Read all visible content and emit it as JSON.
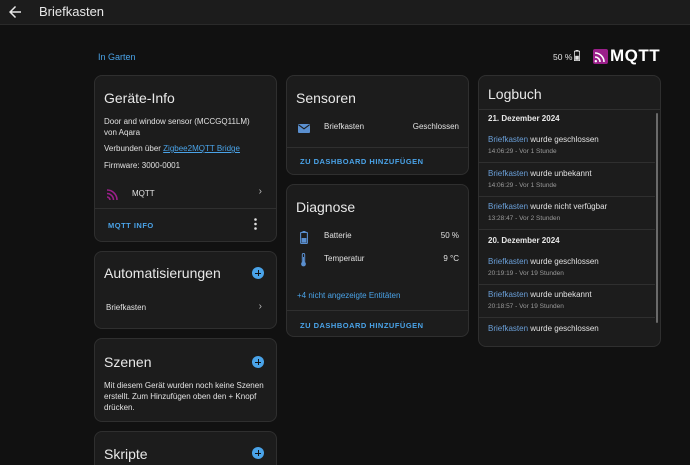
{
  "header": {
    "title": "Briefkasten"
  },
  "area": {
    "link": "In Garten"
  },
  "status": {
    "battery": "50 %"
  },
  "brand": {
    "logo_text": "MQTT",
    "accent": "#9b1f8a"
  },
  "device_info": {
    "title": "Geräte-Info",
    "model": "Door and window sensor (MCCGQ11LM)",
    "manufacturer": "von Aqara",
    "connected_prefix": "Verbunden über ",
    "connected_link": "Zigbee2MQTT Bridge",
    "firmware": "Firmware: 3000-0001",
    "integration_label": "MQTT",
    "button": "MQTT INFO"
  },
  "automations": {
    "title": "Automatisierungen",
    "item": "Briefkasten"
  },
  "scenes": {
    "title": "Szenen",
    "text": "Mit diesem Gerät wurden noch keine Szenen erstellt. Zum Hinzufügen oben den + Knopf drücken."
  },
  "scripts": {
    "title": "Skripte"
  },
  "sensors": {
    "title": "Sensoren",
    "rows": [
      {
        "name": "Briefkasten",
        "value": "Geschlossen"
      }
    ],
    "add_button": "ZU DASHBOARD HINZUFÜGEN"
  },
  "diagnostics": {
    "title": "Diagnose",
    "rows": [
      {
        "name": "Batterie",
        "value": "50 %"
      },
      {
        "name": "Temperatur",
        "value": "9 °C"
      }
    ],
    "hidden_entities": "+4 nicht angezeigte Entitäten",
    "add_button": "ZU DASHBOARD HINZUFÜGEN"
  },
  "logbook": {
    "title": "Logbuch",
    "days": [
      {
        "date": "21. Dezember 2024",
        "entries": [
          {
            "entity": "Briefkasten",
            "text": " wurde geschlossen",
            "time": "14:06:29 - Vor 1 Stunde"
          },
          {
            "entity": "Briefkasten",
            "text": " wurde unbekannt",
            "time": "14:06:29 - Vor 1 Stunde"
          },
          {
            "entity": "Briefkasten",
            "text": " wurde nicht verfügbar",
            "time": "13:28:47 - Vor 2 Stunden"
          }
        ]
      },
      {
        "date": "20. Dezember 2024",
        "entries": [
          {
            "entity": "Briefkasten",
            "text": " wurde geschlossen",
            "time": "20:19:19 - Vor 19 Stunden"
          },
          {
            "entity": "Briefkasten",
            "text": " wurde unbekannt",
            "time": "20:18:57 - Vor 19 Stunden"
          },
          {
            "entity": "Briefkasten",
            "text": " wurde geschlossen",
            "time": ""
          }
        ]
      }
    ]
  }
}
